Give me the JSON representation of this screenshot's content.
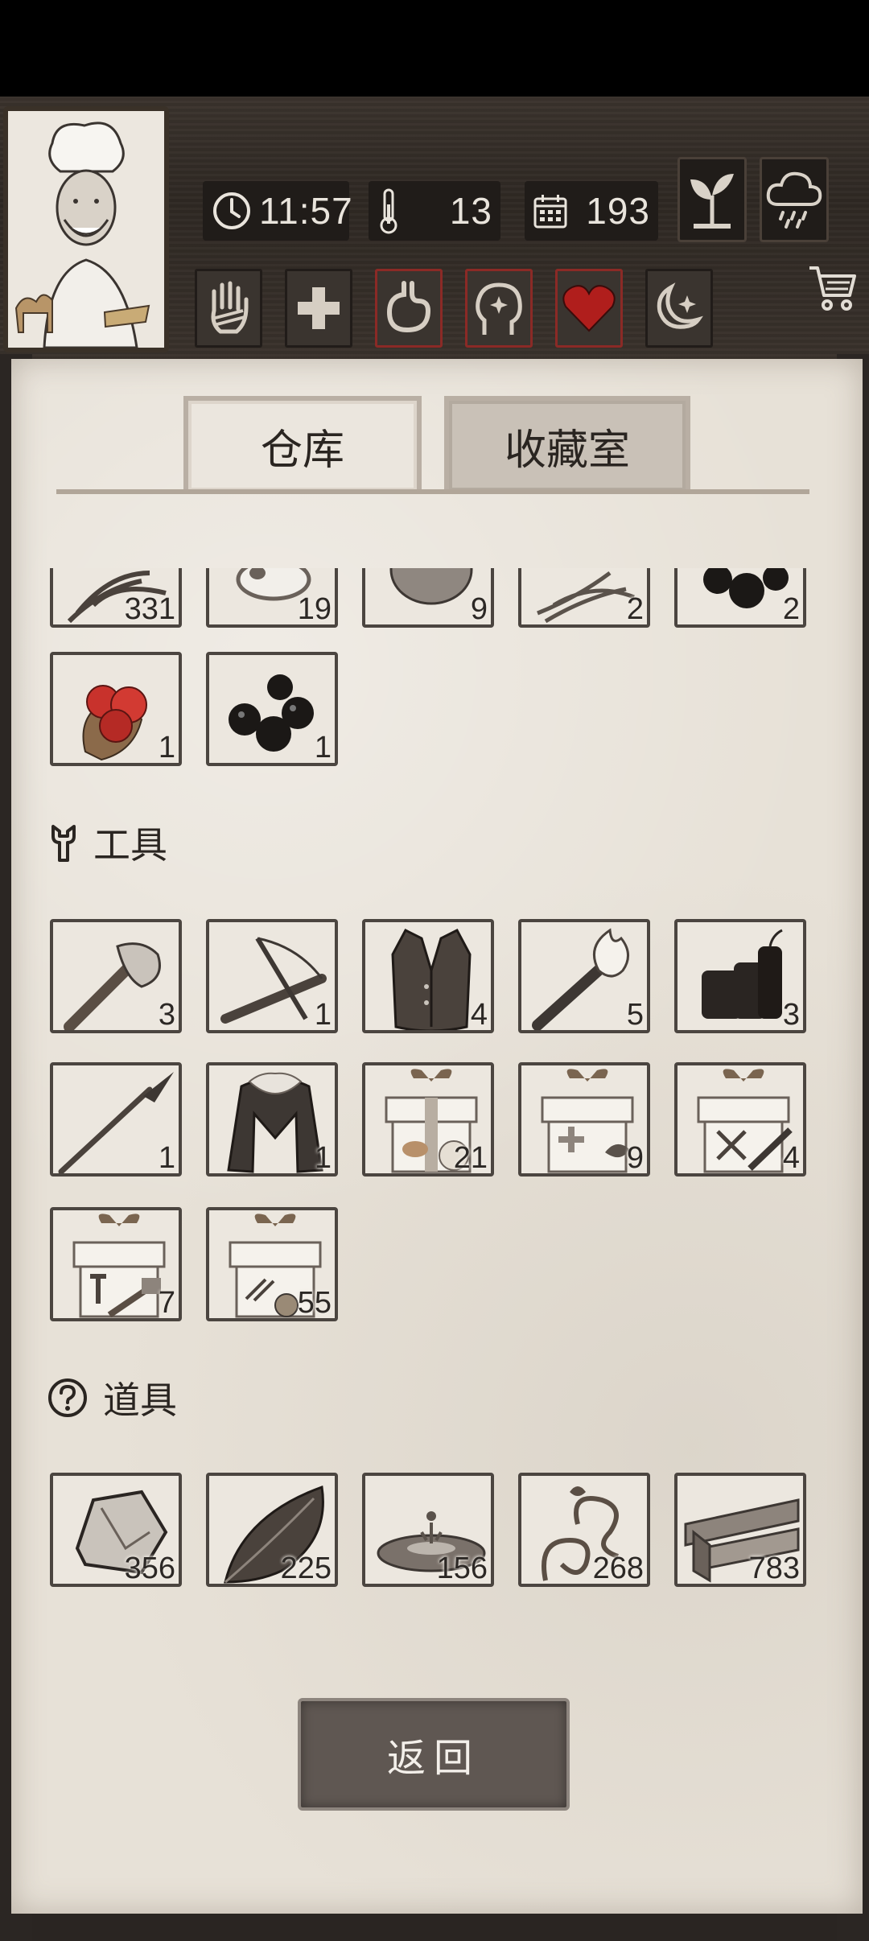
{
  "status_bar": {
    "time": "11:57",
    "temperature": "13",
    "days": "193"
  },
  "status_effects": [
    "hand-icon",
    "medical-cross-icon",
    "stomach-icon",
    "head-sparkle-icon",
    "heart-icon",
    "moon-star-icon"
  ],
  "tabs": [
    {
      "label": "仓库",
      "active": true
    },
    {
      "label": "收藏室",
      "active": false
    }
  ],
  "inventory": {
    "top_row_counts": [
      "331",
      "19",
      "9",
      "2",
      "2"
    ],
    "food_row2": [
      {
        "name": "red-berries-icon",
        "count": "1"
      },
      {
        "name": "black-berries-icon",
        "count": "1"
      }
    ],
    "tools_section": {
      "title": "工具",
      "items": [
        {
          "name": "stone-axe-icon",
          "count": "3"
        },
        {
          "name": "crossbow-icon",
          "count": "1"
        },
        {
          "name": "leather-vest-icon",
          "count": "4"
        },
        {
          "name": "torch-icon",
          "count": "5"
        },
        {
          "name": "dynamite-icon",
          "count": "3"
        },
        {
          "name": "spear-icon",
          "count": "1"
        },
        {
          "name": "fur-coat-icon",
          "count": "1"
        },
        {
          "name": "food-gift-box-icon",
          "count": "21"
        },
        {
          "name": "medical-gift-box-icon",
          "count": "9"
        },
        {
          "name": "weapon-gift-box-icon",
          "count": "4"
        },
        {
          "name": "tool-gift-box-icon",
          "count": "7"
        },
        {
          "name": "material-gift-box-icon",
          "count": "55"
        }
      ]
    },
    "props_section": {
      "title": "道具",
      "items": [
        {
          "name": "stone-icon",
          "count": "356"
        },
        {
          "name": "leaf-icon",
          "count": "225"
        },
        {
          "name": "water-puddle-icon",
          "count": "156"
        },
        {
          "name": "vine-icon",
          "count": "268"
        },
        {
          "name": "wood-planks-icon",
          "count": "783"
        }
      ]
    }
  },
  "back_button": "返回",
  "colors": {
    "paper": "#e7e1d7",
    "slot_border": "#4b4540",
    "alert_border": "#8b2a26",
    "button": "#5f5752"
  }
}
